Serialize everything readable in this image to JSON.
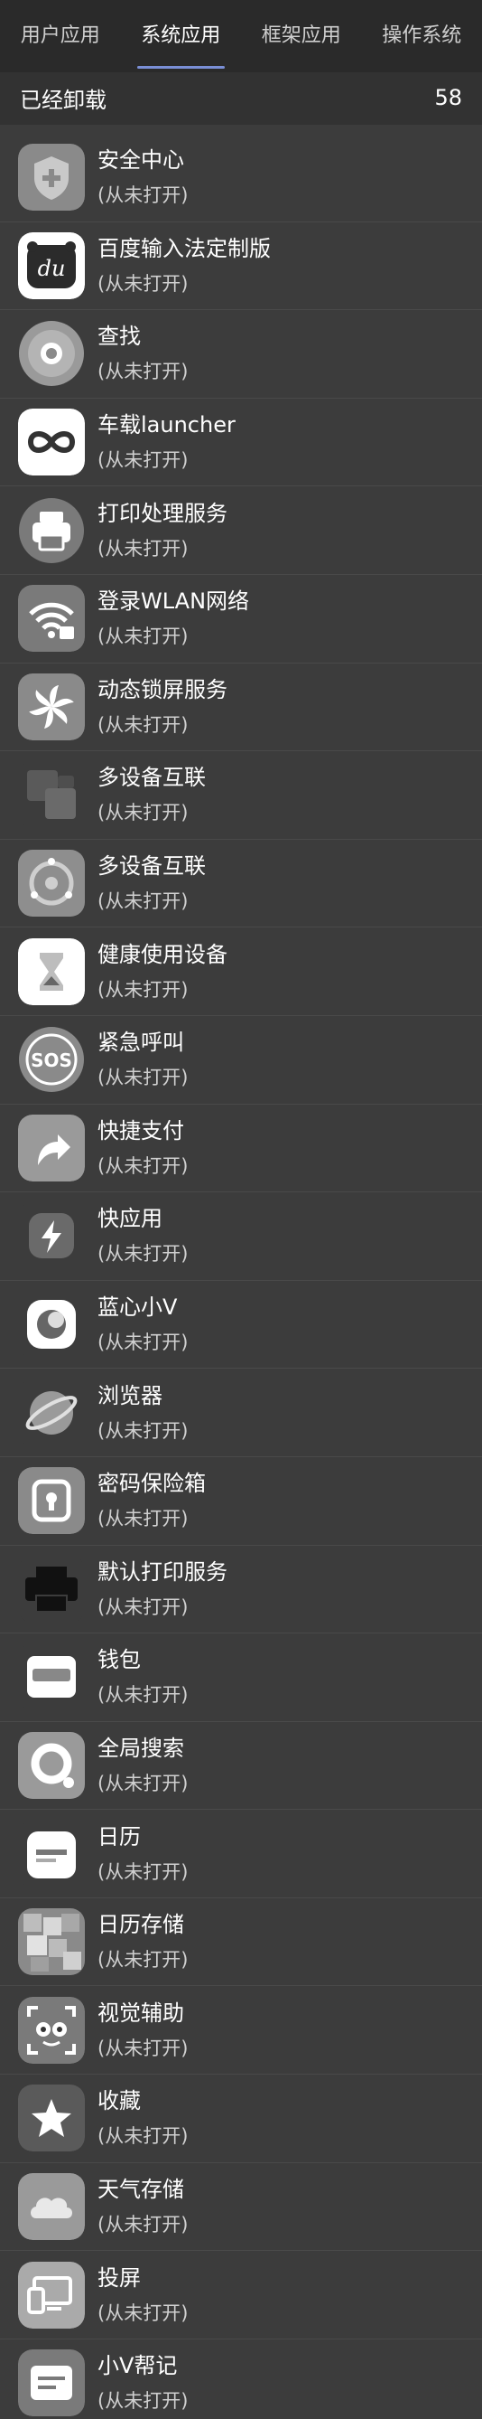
{
  "tabs": [
    {
      "label": "用户应用"
    },
    {
      "label": "系统应用"
    },
    {
      "label": "框架应用"
    },
    {
      "label": "操作系统"
    }
  ],
  "section": {
    "title": "已经卸载",
    "count": "58"
  },
  "apps": [
    {
      "name": "安全中心",
      "status": "(从未打开)",
      "icon": "shield-plus-icon"
    },
    {
      "name": "百度输入法定制版",
      "status": "(从未打开)",
      "icon": "baidu-ime-icon"
    },
    {
      "name": "查找",
      "status": "(从未打开)",
      "icon": "find-device-icon"
    },
    {
      "name": "车载launcher",
      "status": "(从未打开)",
      "icon": "infinity-icon"
    },
    {
      "name": "打印处理服务",
      "status": "(从未打开)",
      "icon": "printer-icon"
    },
    {
      "name": "登录WLAN网络",
      "status": "(从未打开)",
      "icon": "wifi-lock-icon"
    },
    {
      "name": "动态锁屏服务",
      "status": "(从未打开)",
      "icon": "pinwheel-icon"
    },
    {
      "name": "多设备互联",
      "status": "(从未打开)",
      "icon": "multi-square-icon"
    },
    {
      "name": "多设备互联",
      "status": "(从未打开)",
      "icon": "multi-circle-icon"
    },
    {
      "name": "健康使用设备",
      "status": "(从未打开)",
      "icon": "hourglass-icon"
    },
    {
      "name": "紧急呼叫",
      "status": "(从未打开)",
      "icon": "sos-icon"
    },
    {
      "name": "快捷支付",
      "status": "(从未打开)",
      "icon": "arrow-shortcut-icon"
    },
    {
      "name": "快应用",
      "status": "(从未打开)",
      "icon": "lightning-icon"
    },
    {
      "name": "蓝心小V",
      "status": "(从未打开)",
      "icon": "bluev-icon"
    },
    {
      "name": "浏览器",
      "status": "(从未打开)",
      "icon": "planet-icon"
    },
    {
      "name": "密码保险箱",
      "status": "(从未打开)",
      "icon": "vault-icon"
    },
    {
      "name": "默认打印服务",
      "status": "(从未打开)",
      "icon": "printer-black-icon"
    },
    {
      "name": "钱包",
      "status": "(从未打开)",
      "icon": "wallet-icon"
    },
    {
      "name": "全局搜索",
      "status": "(从未打开)",
      "icon": "search-ring-icon"
    },
    {
      "name": "日历",
      "status": "(从未打开)",
      "icon": "calendar-icon"
    },
    {
      "name": "日历存储",
      "status": "(从未打开)",
      "icon": "calendar-storage-icon"
    },
    {
      "name": "视觉辅助",
      "status": "(从未打开)",
      "icon": "visual-assist-icon"
    },
    {
      "name": "收藏",
      "status": "(从未打开)",
      "icon": "star-icon"
    },
    {
      "name": "天气存储",
      "status": "(从未打开)",
      "icon": "cloud-icon"
    },
    {
      "name": "投屏",
      "status": "(从未打开)",
      "icon": "screen-cast-icon"
    },
    {
      "name": "小V帮记",
      "status": "(从未打开)",
      "icon": "note-icon"
    }
  ]
}
